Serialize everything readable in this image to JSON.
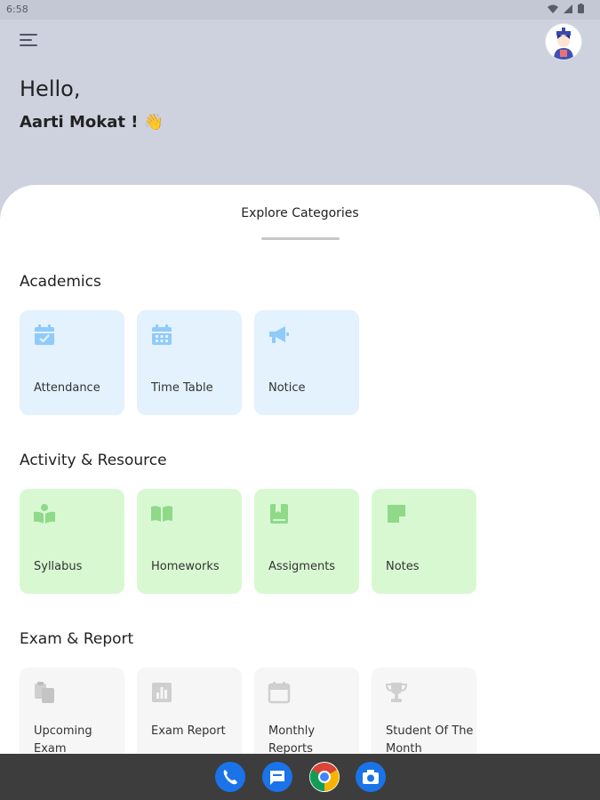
{
  "status": {
    "time": "6:58"
  },
  "greeting": {
    "hello": "Hello,",
    "name": "Aarti Mokat ! 👋"
  },
  "sheet": {
    "title": "Explore Categories"
  },
  "sections": [
    {
      "title": "Academics",
      "color": "#e3f2fd",
      "icon_color": "#90caf9",
      "items": [
        {
          "label": "Attendance",
          "icon": "calendar-check-icon"
        },
        {
          "label": "Time Table",
          "icon": "calendar-grid-icon"
        },
        {
          "label": "Notice",
          "icon": "megaphone-icon"
        }
      ]
    },
    {
      "title": "Activity & Resource",
      "color": "#d8f8d2",
      "icon_color": "#8fd989",
      "items": [
        {
          "label": "Syllabus",
          "icon": "reader-icon"
        },
        {
          "label": "Homeworks",
          "icon": "open-book-icon"
        },
        {
          "label": "Assigments",
          "icon": "book-bookmark-icon"
        },
        {
          "label": "Notes",
          "icon": "sticky-note-icon"
        }
      ]
    },
    {
      "title": "Exam & Report",
      "color": "#f6f6f6",
      "icon_color": "#cfcfcf",
      "items": [
        {
          "label": "Upcoming Exam",
          "icon": "clipboard-copy-icon"
        },
        {
          "label": "Exam Report",
          "icon": "bar-chart-icon"
        },
        {
          "label": "Monthly Reports",
          "icon": "calendar-icon"
        },
        {
          "label": "Student Of The Month",
          "icon": "trophy-icon"
        }
      ]
    }
  ],
  "nav_bar": {
    "apps": [
      "phone-icon",
      "messages-icon",
      "chrome-icon",
      "camera-icon"
    ]
  }
}
